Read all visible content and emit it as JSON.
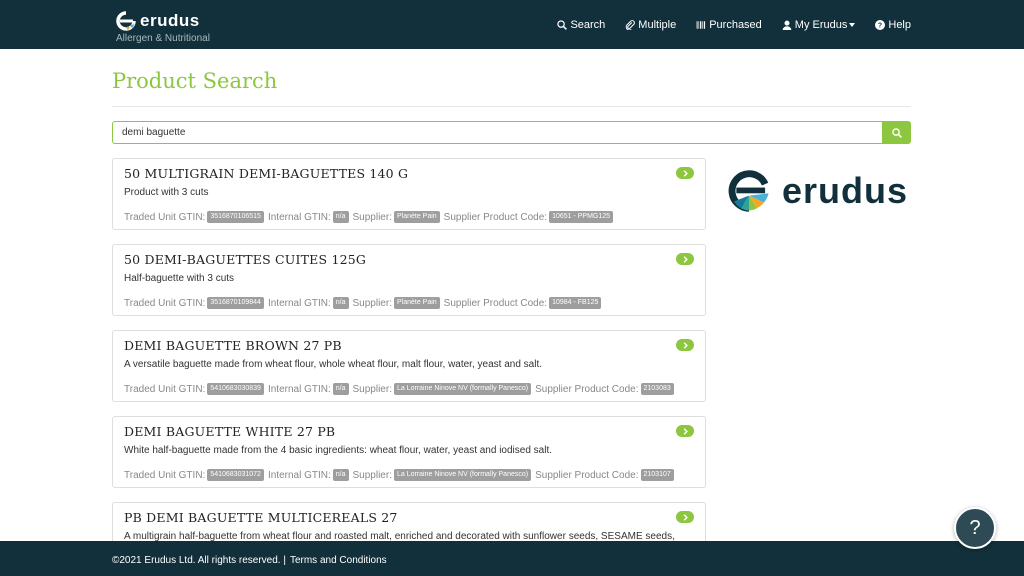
{
  "brand": {
    "name": "erudus",
    "subtitle": "Allergen & Nutritional"
  },
  "nav": [
    {
      "label": "Search",
      "icon": "search-icon"
    },
    {
      "label": "Multiple",
      "icon": "paperclip-icon"
    },
    {
      "label": "Purchased",
      "icon": "barcode-icon"
    },
    {
      "label": "My Erudus",
      "icon": "user-icon"
    },
    {
      "label": "Help",
      "icon": "question-circle-icon"
    }
  ],
  "page": {
    "title": "Product Search"
  },
  "search": {
    "value": "demi baguette"
  },
  "labels": {
    "traded_unit_gtin": "Traded Unit GTIN:",
    "internal_gtin": "Internal GTIN:",
    "supplier": "Supplier:",
    "supplier_product_code": "Supplier Product Code:"
  },
  "results": [
    {
      "title": "50 MULTIGRAIN DEMI-BAGUETTES 140 G",
      "description": "Product with 3 cuts",
      "traded_unit_gtin": "3516870106515",
      "internal_gtin": "n/a",
      "supplier": "Planète Pain",
      "supplier_product_code": "10651 - PPMG125"
    },
    {
      "title": "50 DEMI-BAGUETTES CUITES 125G",
      "description": "Half-baguette with 3 cuts",
      "traded_unit_gtin": "3516870109844",
      "internal_gtin": "n/a",
      "supplier": "Planète Pain",
      "supplier_product_code": "10984 - FB125"
    },
    {
      "title": "DEMI BAGUETTE BROWN 27 PB",
      "description": "A versatile baguette made from wheat flour, whole wheat flour, malt flour, water, yeast and salt.",
      "traded_unit_gtin": "5410683030839",
      "internal_gtin": "n/a",
      "supplier": "La Lorraine Ninove NV (formally Panesco)",
      "supplier_product_code": "2103083"
    },
    {
      "title": "DEMI BAGUETTE WHITE 27 PB",
      "description": "White half-baguette made from the 4 basic ingredients: wheat flour, water, yeast and iodised salt.",
      "traded_unit_gtin": "5410683031072",
      "internal_gtin": "n/a",
      "supplier": "La Lorraine Ninove NV (formally Panesco)",
      "supplier_product_code": "2103107"
    },
    {
      "title": "PB DEMI BAGUETTE MULTICEREALS 27",
      "description": "A multigrain half-baguette from wheat flour and roasted malt, enriched and decorated with sunflower seeds, SESAME seeds, linseed and wheat bran."
    }
  ],
  "side_logo": {
    "name": "erudus"
  },
  "footer": {
    "copyright": "©2021 Erudus Ltd. All rights reserved. |",
    "terms": "Terms and Conditions"
  },
  "help_bubble": {
    "label": "?"
  },
  "colors": {
    "navbar": "#12303b",
    "accent": "#8dc63f",
    "badge": "#9e9e9e"
  }
}
